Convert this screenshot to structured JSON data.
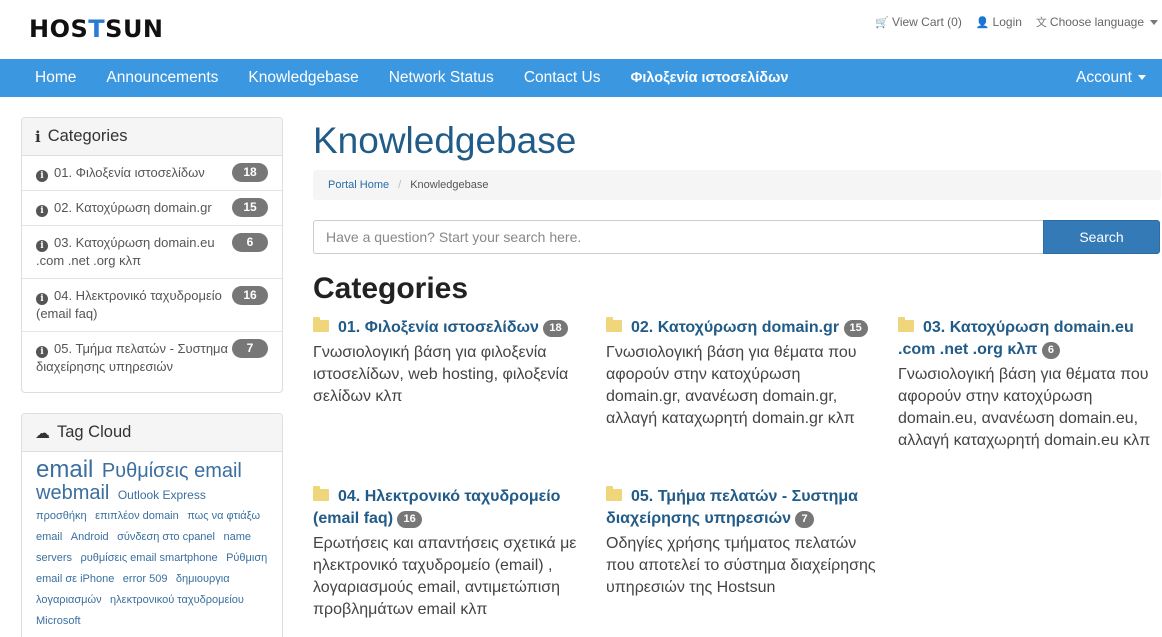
{
  "brand": {
    "logo_prefix": "HOS",
    "logo_t": "T",
    "logo_suffix": "SUN"
  },
  "toplinks": {
    "cart": "View Cart (0)",
    "login": "Login",
    "language": "Choose language"
  },
  "nav": {
    "items": [
      "Home",
      "Announcements",
      "Knowledgebase",
      "Network Status",
      "Contact Us",
      "Φιλοξενία ιστοσελίδων"
    ],
    "account": "Account"
  },
  "sidebar": {
    "categories_title": "Categories",
    "categories": [
      {
        "label": "01. Φιλοξενία ιστοσελίδων",
        "count": "18"
      },
      {
        "label": "02. Κατοχύρωση domain.gr",
        "count": "15"
      },
      {
        "label": "03. Κατοχύρωση domain.eu .com .net .org κλπ",
        "count": "6"
      },
      {
        "label": "04. Ηλεκτρονικό ταχυδρομείο (email faq)",
        "count": "16"
      },
      {
        "label": "05. Τμήμα πελατών - Συστημα διαχείρησης υπηρεσιών",
        "count": "7"
      }
    ],
    "tagcloud_title": "Tag Cloud",
    "tags": [
      {
        "text": "email",
        "size": 24
      },
      {
        "text": "Ρυθμίσεις email",
        "size": 20
      },
      {
        "text": "webmail",
        "size": 20
      },
      {
        "text": "Outlook Express",
        "size": 12
      },
      {
        "text": "προσθήκη",
        "size": 11
      },
      {
        "text": "επιπλέον domain",
        "size": 11
      },
      {
        "text": "πως να φτιάξω email",
        "size": 11
      },
      {
        "text": "Android",
        "size": 11
      },
      {
        "text": "σύνδεση στο cpanel",
        "size": 11
      },
      {
        "text": "name servers",
        "size": 11
      },
      {
        "text": "ρυθμίσεις email smartphone",
        "size": 11
      },
      {
        "text": "Ρύθμιση email σε iPhone",
        "size": 11
      },
      {
        "text": "error 509",
        "size": 11
      },
      {
        "text": "δημιουργια λογαριασμών",
        "size": 11
      },
      {
        "text": "ηλεκτρονικού ταχυδρομείου",
        "size": 11
      },
      {
        "text": "Microsoft",
        "size": 11
      }
    ]
  },
  "main": {
    "title": "Knowledgebase",
    "breadcrumb": {
      "home": "Portal Home",
      "current": "Knowledgebase"
    },
    "search": {
      "placeholder": "Have a question? Start your search here.",
      "button": "Search"
    },
    "section_title": "Categories",
    "categories": [
      {
        "name": "01. Φιλοξενία ιστοσελίδων",
        "count": "18",
        "desc": "Γνωσιολογική βάση για φιλοξενία ιστοσελίδων, web hosting, φιλοξενία σελίδων κλπ"
      },
      {
        "name": "02. Κατοχύρωση domain.gr",
        "count": "15",
        "desc": "Γνωσιολογική βάση για θέματα που αφορούν στην κατοχύρωση domain.gr, ανανέωση domain.gr, αλλαγή καταχωρητή domain.gr κλπ"
      },
      {
        "name": "03. Κατοχύρωση domain.eu .com .net .org κλπ",
        "count": "6",
        "desc": "Γνωσιολογική βάση για θέματα που αφορούν στην κατοχύρωση domain.eu, ανανέωση domain.eu, αλλαγή καταχωρητή domain.eu κλπ"
      },
      {
        "name": "04. Ηλεκτρονικό ταχυδρομείο (email faq)",
        "count": "16",
        "desc": "Ερωτήσεις και απαντήσεις σχετικά με ηλεκτρονικό ταχυδρομείο (email) , λογαριασμούς email, αντιμετώπιση προβλημάτων email κλπ"
      },
      {
        "name": "05. Τμήμα πελατών - Συστημα διαχείρησης υπηρεσιών",
        "count": "7",
        "desc": "Οδηγίες χρήσης τμήματος πελατών που αποτελεί το σύστημα διαχείρησης υπηρεσιών της Hostsun"
      }
    ]
  }
}
